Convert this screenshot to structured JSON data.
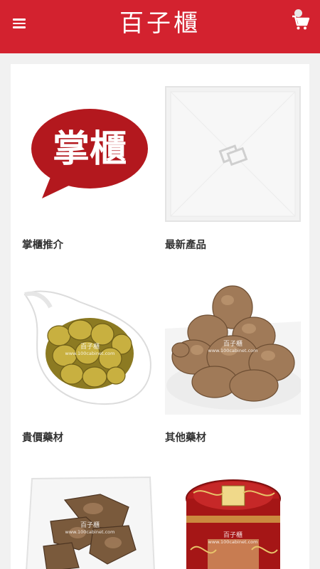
{
  "header": {
    "brand": "百子櫃",
    "menu_icon": "hamburger-menu-icon",
    "cart_icon": "shopping-cart-icon",
    "background": "#d3222f"
  },
  "grid": {
    "items": [
      {
        "label": "掌櫃推介",
        "image": "掌櫃 speech-bubble logo",
        "logo_text": "掌櫃"
      },
      {
        "label": "最新產品",
        "image": "image-placeholder-icon"
      },
      {
        "label": "貴價藥材",
        "image": "dried herb coils in white spoon"
      },
      {
        "label": "其他藥材",
        "image": "dried roots on white plate"
      },
      {
        "label": "",
        "image": "dried herb slices on white plate"
      },
      {
        "label": "",
        "image": "red tin of pills"
      }
    ],
    "watermark": "百子櫃",
    "watermark_url": "www.100cabinet.com"
  }
}
